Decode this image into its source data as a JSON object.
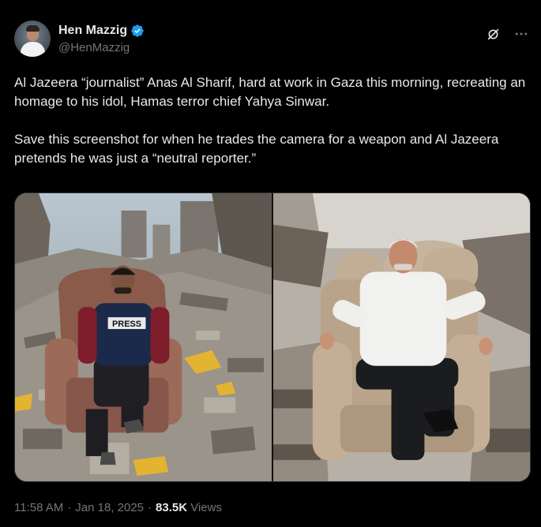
{
  "author": {
    "display_name": "Hen Mazzig",
    "handle": "@HenMazzig",
    "verified": true
  },
  "icons": {
    "verified": "verified-badge-icon",
    "grok": "grok-icon",
    "more": "more-icon"
  },
  "colors": {
    "background": "#000000",
    "text": "#e7e9ea",
    "muted": "#71767b",
    "verified": "#1d9bf0",
    "border": "#2f3336"
  },
  "tweet": {
    "paragraphs": [
      "Al Jazeera “journalist” Anas Al Sharif, hard at work in Gaza this morning, recreating an homage to his idol, Hamas terror chief Yahya Sinwar.",
      "Save this screenshot for when he trades the camera for a weapon and Al Jazeera pretends he was just a “neutral reporter.”"
    ]
  },
  "media": {
    "left_photo_vest_text": "PRESS"
  },
  "meta": {
    "time": "11:58 AM",
    "separator": "·",
    "date": "Jan 18, 2025",
    "views_count": "83.5K",
    "views_label": "Views"
  }
}
